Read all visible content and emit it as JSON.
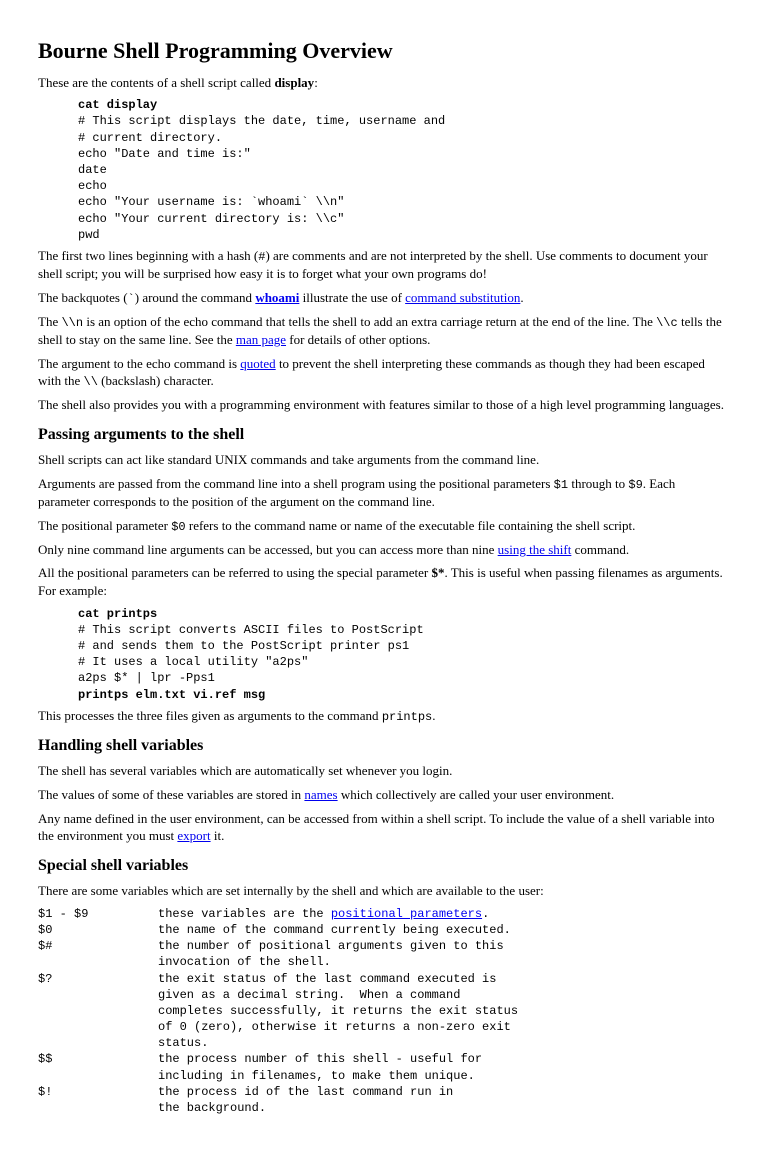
{
  "title": "Bourne Shell Programming Overview",
  "intro": {
    "p1a": "These are the contents of a shell script called ",
    "p1b": "display",
    "p1c": ":"
  },
  "code1": {
    "l1": "cat display",
    "l2": "# This script displays the date, time, username and",
    "l3": "# current directory.",
    "l4": "echo \"Date and time is:\"",
    "l5": "date",
    "l6": "echo",
    "l7": "echo \"Your username is: `whoami` \\\\n\"",
    "l8": "echo \"Your current directory is: \\\\c\"",
    "l9": "pwd"
  },
  "body1": {
    "p1a": "The first two lines beginning with a hash (",
    "p1hash": "#",
    "p1b": ") are comments and are not interpreted by the shell. Use comments to document your shell script; you will be surprised how easy it is to forget what your own programs do!",
    "p2a": "The backquotes (",
    "p2bt": "`",
    "p2b": ") around the command ",
    "p2link": "whoami",
    "p2c": " illustrate the use of ",
    "p2link2": "command substitution",
    "p2d": ".",
    "p3a": "The ",
    "p3n": "\\\\n",
    "p3b": " is an option of the echo command that tells the shell to add an extra carriage return at the end of the line. The ",
    "p3c": "\\\\c",
    "p3d": " tells the shell to stay on the same line. See the ",
    "p3link": "man page",
    "p3e": " for details of other options.",
    "p4a": "The argument to the echo command is ",
    "p4link": "quoted",
    "p4b": " to prevent the shell interpreting these commands as though they had been escaped with the ",
    "p4bs": "\\\\",
    "p4c": " (backslash) character.",
    "p5": "The shell also provides you with a programming environment with features similar to those of a high level programming languages."
  },
  "h2a": "Passing arguments to the shell",
  "args": {
    "p1": "Shell scripts can act like standard UNIX commands and take arguments from the command line.",
    "p2a": "Arguments are passed from the command line into a shell program using the positional parameters ",
    "p2m1": "$1",
    "p2b": " through to ",
    "p2m2": "$9",
    "p2c": ". Each parameter corresponds to the position of the argument on the command line.",
    "p3a": "The positional parameter ",
    "p3m": "$0",
    "p3b": " refers to the command name or name of the executable file containing the shell script.",
    "p4a": "Only nine command line arguments can be accessed, but you can access more than nine ",
    "p4link": "using the shift",
    "p4b": " command.",
    "p5a": "All the positional parameters can be referred to using the special parameter ",
    "p5m": "$*",
    "p5b": ". This is useful when passing filenames as arguments. For example:"
  },
  "code2": {
    "l1": "cat printps",
    "l2": "# This script converts ASCII files to PostScript",
    "l3": "# and sends them to the PostScript printer ps1",
    "l4": "# It uses a local utility \"a2ps\"",
    "l5": "a2ps $* | lpr -Pps1",
    "l6": "printps elm.txt vi.ref msg"
  },
  "after2": {
    "a": "This processes the three files given as arguments to the command ",
    "m": "printps",
    "b": "."
  },
  "h2b": "Handling shell variables",
  "hand": {
    "p1": "The shell has several variables which are automatically set whenever you login.",
    "p2a": "The values of some of these variables are stored in ",
    "p2link": "names",
    "p2b": " which collectively are called your user environment.",
    "p3a": "Any name defined in the user environment, can be accessed from within a shell script. To include the value of a shell variable into the environment you must ",
    "p3link": "export",
    "p3b": " it."
  },
  "h2c": "Special shell variables",
  "spec": {
    "p1": "There are some variables which are set internally by the shell and which are available to the user:"
  },
  "table": {
    "r1": {
      "c1": "$1 - $9",
      "c2a": "these variables are the ",
      "link": "positional parameters",
      "c2b": "."
    },
    "r2": {
      "c1": "$0",
      "c2": "the name of the command currently being executed."
    },
    "r3": {
      "c1": "$#",
      "c2": "the number of positional arguments given to this\ninvocation of the shell."
    },
    "r4": {
      "c1": "$?",
      "c2": "the exit status of the last command executed is\ngiven as a decimal string.  When a command\ncompletes successfully, it returns the exit status\nof 0 (zero), otherwise it returns a non-zero exit\nstatus."
    },
    "r5": {
      "c1": "$$",
      "c2": "the process number of this shell - useful for\nincluding in filenames, to make them unique."
    },
    "r6": {
      "c1": "$!",
      "c2": "the process id of the last command run in\nthe background."
    }
  }
}
